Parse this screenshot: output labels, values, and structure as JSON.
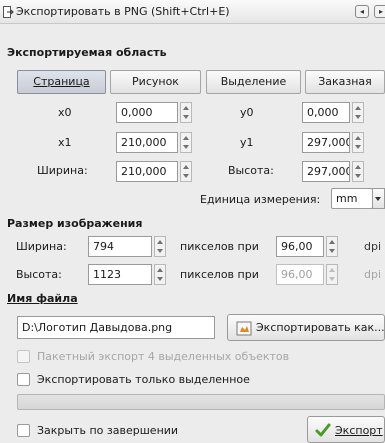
{
  "window": {
    "title": "Экспортировать в PNG (Shift+Ctrl+E)",
    "btn_a": "◂",
    "btn_b": "▸"
  },
  "area": {
    "heading": "Экспортируемая область",
    "tabs": [
      {
        "label": "Страница",
        "active": true
      },
      {
        "label": "Рисунок",
        "active": false
      },
      {
        "label": "Выделение",
        "active": false
      },
      {
        "label": "Заказная",
        "active": false
      }
    ],
    "x0_label": "x0",
    "x0": "0,000",
    "y0_label": "y0",
    "y0": "0,000",
    "x1_label": "x1",
    "x1": "210,000",
    "y1_label": "y1",
    "y1": "297,000",
    "width_label": "Ширина:",
    "width": "210,000",
    "height_label": "Высота:",
    "height": "297,000",
    "unit_label": "Единица измерения:",
    "unit": "mm"
  },
  "image_size": {
    "heading": "Размер изображения",
    "width_label": "Ширина:",
    "width_px": "794",
    "pixels_at_1": "пикселов при",
    "dpi_1": "96,00",
    "dpi_label_1": "dpi",
    "height_label": "Высота:",
    "height_px": "1123",
    "pixels_at_2": "пикселов при",
    "dpi_2": "96,00",
    "dpi_label_2": "dpi"
  },
  "filename": {
    "heading": "Имя файла",
    "value": "D:\\Логотип Давыдова.png",
    "export_as_button": "Экспортировать как..."
  },
  "options": {
    "batch_export": "Пакетный экспорт 4 выделенных объектов",
    "only_selected": "Экспортировать только выделенное"
  },
  "footer": {
    "close_when_done": "Закрыть по завершении",
    "export_button": "Экспорт"
  },
  "colors": {
    "background": "#ececec",
    "active_tab": "#cfd4dd",
    "check_icon": "#4a9a2a"
  }
}
